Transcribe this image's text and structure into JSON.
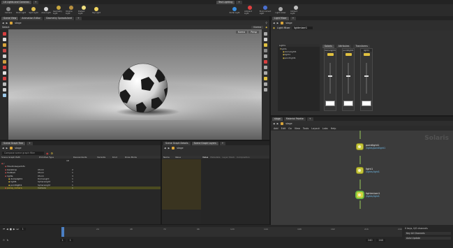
{
  "top_tabs": {
    "left": [
      "Lit Lights and Cameras",
      "+"
    ],
    "right": [
      "Test Lighting",
      "+"
    ]
  },
  "shelf_left": [
    {
      "label": "Camera",
      "icon": "camera-icon",
      "color": "#8a8a8a"
    },
    {
      "label": "Point Light",
      "icon": "point-light-icon",
      "color": "#e8d070"
    },
    {
      "label": "Spot Light",
      "icon": "spot-light-icon",
      "color": "#e0c050"
    },
    {
      "label": "Area Light",
      "icon": "area-light-icon",
      "color": "#d8d8d8"
    },
    {
      "label": "Geometry Light",
      "icon": "geometry-light-icon",
      "color": "#c9a840"
    },
    {
      "label": "Volume Light",
      "icon": "volume-light-icon",
      "color": "#b89040"
    },
    {
      "label": "Distant Light",
      "icon": "distant-light-icon",
      "color": "#f0e080"
    },
    {
      "label": "Sky Light",
      "icon": "sky-light-icon",
      "color": "#f3d760"
    }
  ],
  "shelf_right": [
    {
      "label": "Portal Light",
      "icon": "portal-light-icon",
      "color": "#3a8fe0"
    },
    {
      "label": "Ambient Light",
      "icon": "ambient-light-icon",
      "color": "#e04040"
    },
    {
      "label": "Environment Light",
      "icon": "environment-light-icon",
      "color": "#4a70d0"
    },
    {
      "label": "Light Linker",
      "icon": "light-linker-icon",
      "color": "#aaaaaa"
    },
    {
      "label": "Indirect Light",
      "icon": "indirect-light-icon",
      "color": "#c0c0c0"
    }
  ],
  "viewport": {
    "tabs": [
      "Scene View",
      "Animation Editor",
      "Geometry Spreadsheet",
      "+"
    ],
    "path": "stage",
    "toolbar_label": "Select",
    "view_menu": "Karma",
    "camera_menu": "Persp",
    "renderer": "Karma"
  },
  "scene_graph": {
    "tabs": [
      "Scene Graph Tree",
      "+"
    ],
    "path": "stage",
    "filter_placeholder": "Compose scene graph filter",
    "columns": [
      "Scene Graph Path",
      "Primitive Type",
      "Descendants",
      "Variants",
      "Kind",
      "Draw Mode"
    ],
    "rows": [
      {
        "name": "/",
        "type": "",
        "desc": "",
        "indent": 0,
        "selected": false
      },
      {
        "name": "HoudiniLayerInfo",
        "type": "",
        "desc": "",
        "indent": 1,
        "selected": false
      },
      {
        "name": "backdrop",
        "type": "Xform",
        "desc": "2",
        "indent": 1,
        "selected": false
      },
      {
        "name": "football",
        "type": "Xform",
        "desc": "1",
        "indent": 1,
        "selected": false
      },
      {
        "name": "lights",
        "type": "Xform",
        "desc": "3",
        "indent": 1,
        "selected": false
      },
      {
        "name": "domelight1",
        "type": "DomeLight",
        "desc": "1",
        "indent": 2,
        "selected": false
      },
      {
        "name": "light1",
        "type": "SphereLight",
        "desc": "1",
        "indent": 2,
        "selected": false
      },
      {
        "name": "pointlight1",
        "type": "SphereLight",
        "desc": "1",
        "indent": 2,
        "selected": false
      },
      {
        "name": "persp_camera",
        "type": "Camera",
        "desc": "1",
        "indent": 1,
        "selected": true
      }
    ],
    "total_desc": "18"
  },
  "scene_graph_details": {
    "tabs": [
      "Scene Graph Details",
      "Scene Graph Layers",
      "+"
    ],
    "path": "stage",
    "columns": [
      "Name",
      "Value"
    ],
    "right_tabs": [
      "Value",
      "Metadata",
      "Layer Stack",
      "Composition"
    ]
  },
  "light_mixer": {
    "tabs": [
      "Light Mixer",
      "+"
    ],
    "node_name": "lightmixer1",
    "tree_header": "Lights",
    "tree": [
      {
        "name": "lights",
        "indent": 0
      },
      {
        "name": "domelight1",
        "indent": 1
      },
      {
        "name": "light1",
        "indent": 1
      },
      {
        "name": "pointlight1",
        "indent": 1
      }
    ],
    "panel_tabs": [
      "Solaris",
      "Attributes",
      "Transforms"
    ],
    "channels": [
      "domelight1",
      "pointlight1",
      "light1"
    ]
  },
  "network": {
    "tabs": [
      "stage",
      "Material Palette",
      "+"
    ],
    "path": "stage",
    "menus": [
      "Add",
      "Edit",
      "Go",
      "View",
      "Tools",
      "Layout",
      "Labs",
      "Help"
    ],
    "context_label": "Solaris",
    "nodes": [
      {
        "name": "pointlight1",
        "sub": "/lights/pointlight1"
      },
      {
        "name": "light1",
        "sub": "/lights/light1"
      },
      {
        "name": "lightmixer1",
        "sub": "/lights/light1"
      }
    ]
  },
  "timeline": {
    "frame": "1",
    "start": "1",
    "end": "1",
    "range_start": "240",
    "range_end": "240",
    "ticks": [
      "1",
      "24",
      "48",
      "72",
      "96",
      "120",
      "144",
      "168",
      "192",
      "216",
      "240"
    ],
    "keys_label": "0 keys, 0/0 channels",
    "key_all": "Key All Channels",
    "auto_update": "Auto Update"
  }
}
